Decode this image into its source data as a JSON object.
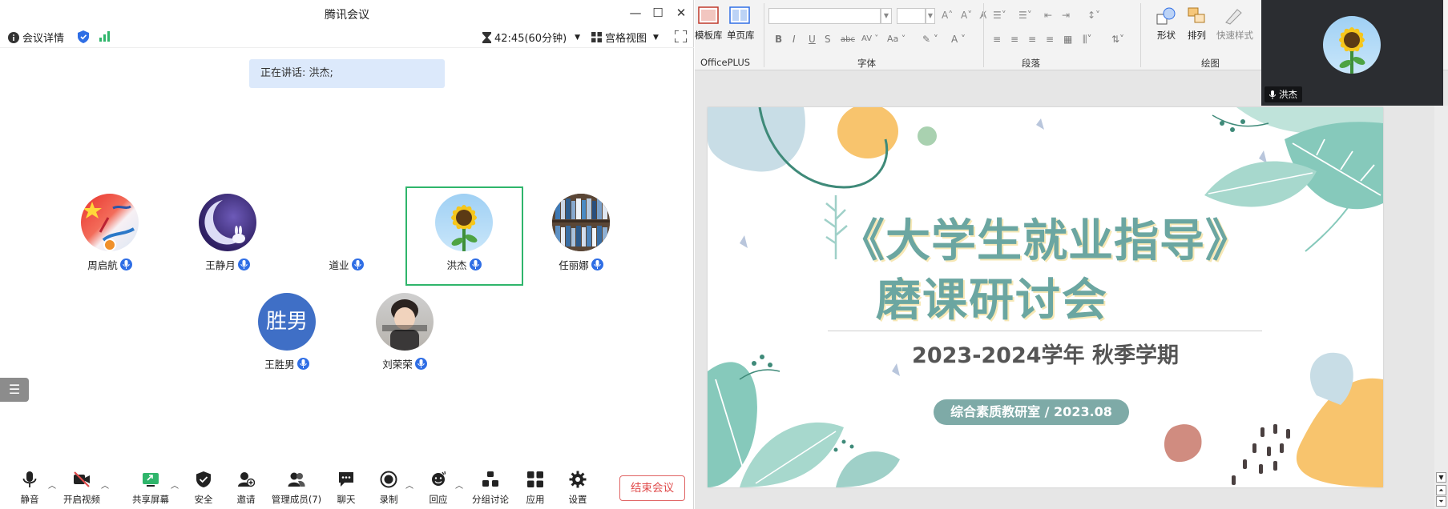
{
  "window": {
    "title": "腾讯会议"
  },
  "infobar": {
    "details_label": "会议详情",
    "timer": "42:45(60分钟)",
    "view_label": "宫格视图"
  },
  "speaking": {
    "text": "正在讲话: 洪杰;"
  },
  "participants": [
    {
      "name": "周启航",
      "avatar": "flag-avatar"
    },
    {
      "name": "王静月",
      "avatar": "moon-rabbit-avatar"
    },
    {
      "name": "道业",
      "avatar": "none"
    },
    {
      "name": "洪杰",
      "avatar": "sunflower-avatar"
    },
    {
      "name": "任丽娜",
      "avatar": "bookshelf-avatar"
    },
    {
      "name": "王胜男",
      "avatar": "initials",
      "initials": "胜男"
    },
    {
      "name": "刘荣荣",
      "avatar": "child-avatar"
    }
  ],
  "toolbar": {
    "mute": "静音",
    "video": "开启视频",
    "share": "共享屏幕",
    "security": "安全",
    "invite": "邀请",
    "members": "管理成员(7)",
    "chat": "聊天",
    "record": "录制",
    "react": "回应",
    "breakout": "分组讨论",
    "apps": "应用",
    "settings": "设置",
    "end": "结束会议"
  },
  "ribbon": {
    "template_lib": "模板库",
    "single_page_lib": "单页库",
    "officeplus": "OfficePLUS",
    "font_group": "字体",
    "paragraph_group": "段落",
    "drawing_group": "绘图",
    "shape": "形状",
    "arrange": "排列",
    "quick_style": "快速样式"
  },
  "video_thumb": {
    "name": "洪杰"
  },
  "slide": {
    "title_line1": "《大学生就业指导》",
    "title_line2": "磨课研讨会",
    "term": "2023-2024学年 秋季学期",
    "pill": "综合素质教研室 / 2023.08"
  },
  "colors": {
    "accent_green": "#2fb56b",
    "mic_blue": "#2f6ee5",
    "end_red": "#e04b4b",
    "slide_teal": "#6ba6a1"
  }
}
